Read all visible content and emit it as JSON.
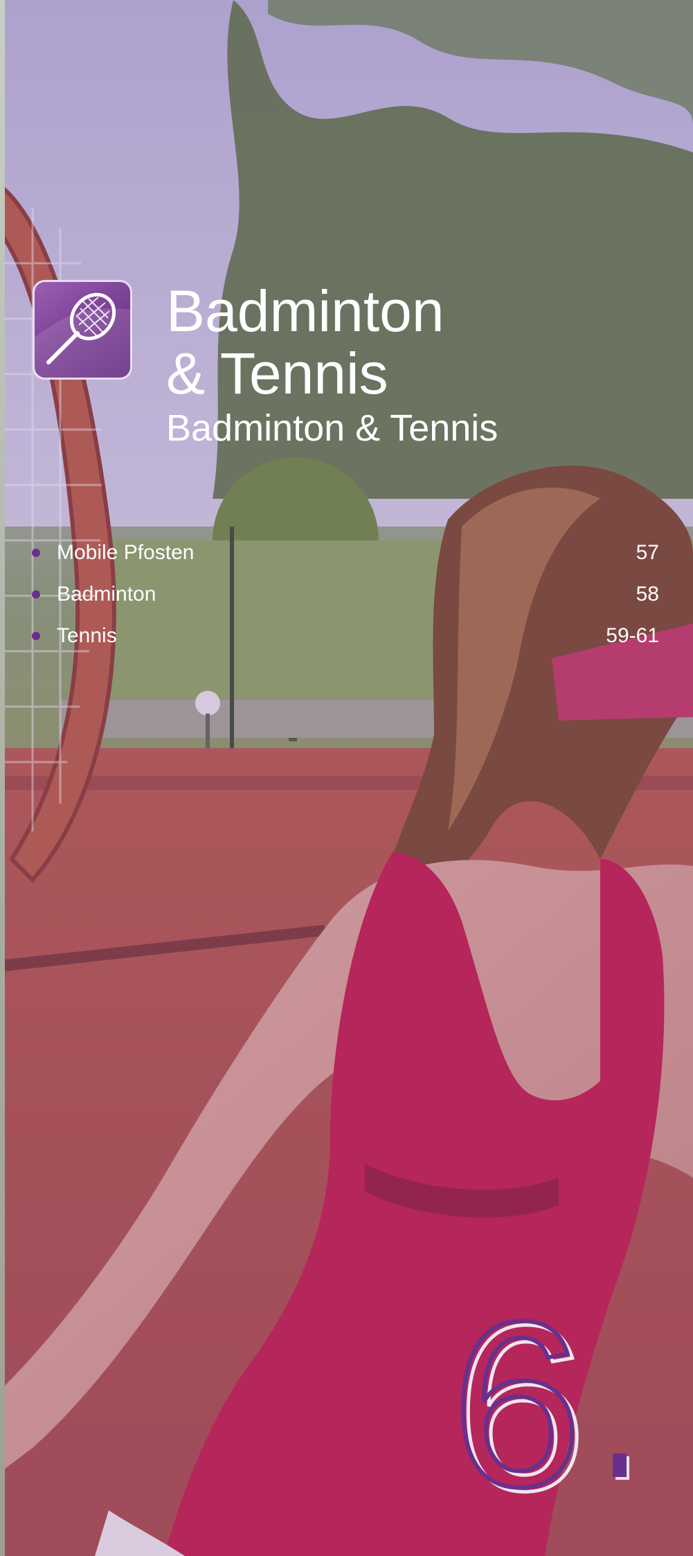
{
  "header": {
    "title_line1": "Badminton",
    "title_line2": "& Tennis",
    "subtitle": "Badminton & Tennis",
    "icon": "tennis-racket-icon"
  },
  "toc": {
    "items": [
      {
        "label": "Mobile Pfosten",
        "pages": "57"
      },
      {
        "label": "Badminton",
        "pages": "58"
      },
      {
        "label": "Tennis",
        "pages": "59-61"
      }
    ]
  },
  "chapter": {
    "number": "6"
  },
  "colors": {
    "accent": "#6a2f8c",
    "text": "#ffffff",
    "tint": "#7a3f96"
  }
}
